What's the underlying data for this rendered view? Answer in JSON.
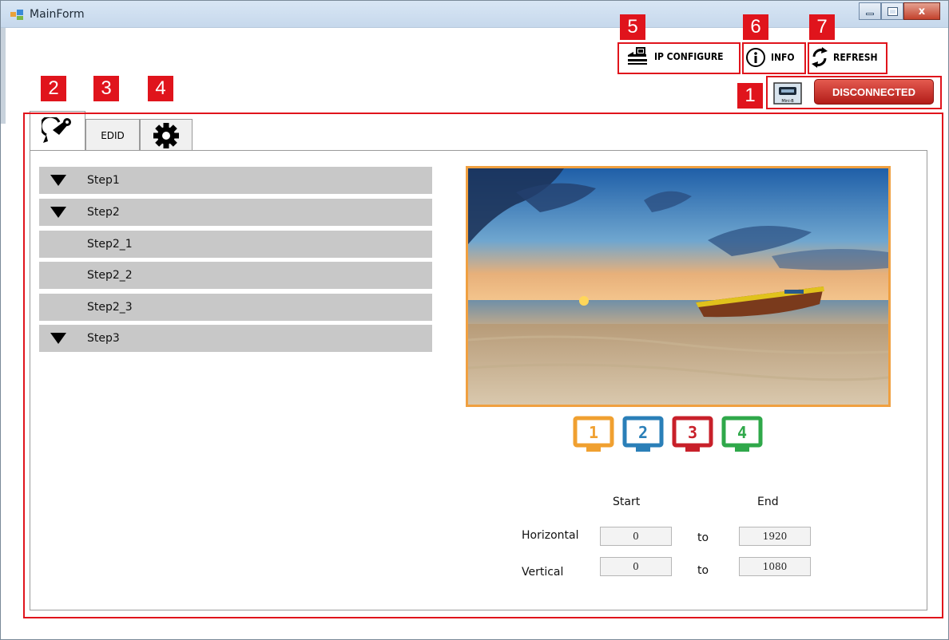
{
  "window": {
    "title": "MainForm",
    "close_label": "x"
  },
  "toolbar": {
    "ip_configure_label": "IP CONFIGURE",
    "info_label": "INFO",
    "refresh_label": "REFRESH"
  },
  "connection": {
    "status_label": "DISCONNECTED",
    "usb_icon_caption": "Mini-B"
  },
  "tabs": [
    {
      "label": "",
      "icon": "wrench-icon",
      "active": true
    },
    {
      "label": "EDID",
      "icon": null,
      "active": false
    },
    {
      "label": "",
      "icon": "gear-icon",
      "active": false
    }
  ],
  "steps": [
    {
      "label": "Step1",
      "expandable": true
    },
    {
      "label": "Step2",
      "expandable": true
    },
    {
      "label": "Step2_1",
      "expandable": false
    },
    {
      "label": "Step2_2",
      "expandable": false
    },
    {
      "label": "Step2_3",
      "expandable": false
    },
    {
      "label": "Step3",
      "expandable": true
    }
  ],
  "monitors": [
    {
      "label": "1",
      "color": "#f0a030"
    },
    {
      "label": "2",
      "color": "#2a7fb8"
    },
    {
      "label": "3",
      "color": "#c8202a"
    },
    {
      "label": "4",
      "color": "#2fa84a"
    }
  ],
  "range": {
    "start_header": "Start",
    "end_header": "End",
    "horizontal_label": "Horizontal",
    "vertical_label": "Vertical",
    "to_label": "to",
    "h_start": "0",
    "h_end": "1920",
    "v_start": "0",
    "v_end": "1080"
  },
  "annotations": {
    "n1": "1",
    "n2": "2",
    "n3": "3",
    "n4": "4",
    "n5": "5",
    "n6": "6",
    "n7": "7",
    "color": "#e0141c"
  }
}
